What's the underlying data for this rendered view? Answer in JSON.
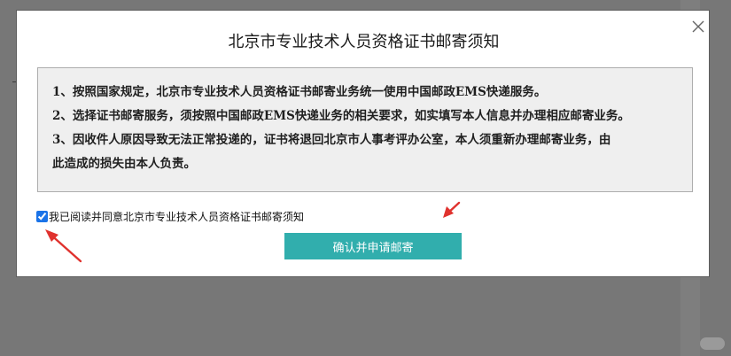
{
  "dialog": {
    "title": "北京市专业技术人员资格证书邮寄须知",
    "notice_lines": [
      "1、按照国家规定，北京市专业技术人员资格证书邮寄业务统一使用中国邮政EMS快递服务。",
      "2、选择证书邮寄服务，须按照中国邮政EMS快递业务的相关要求，如实填写本人信息并办理相应邮寄业务。",
      "3、因收件人原因导致无法正常投递的，证书将退回北京市人事考评办公室，本人须重新办理邮寄业务，由",
      "此造成的损失由本人负责。"
    ],
    "agree_label": "我已阅读并同意北京市专业技术人员资格证书邮寄须知",
    "agree_checked": true,
    "confirm_label": "确认并申请邮寄",
    "close_icon": "close-icon"
  },
  "colors": {
    "overlay": "#777777",
    "button": "#31aead",
    "notice_bg": "#efefef",
    "annotation_arrow": "#e0322e"
  }
}
